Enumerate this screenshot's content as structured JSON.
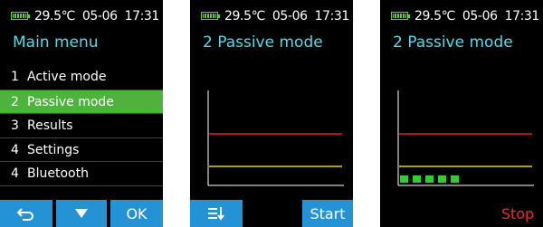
{
  "status": {
    "temperature": "29.5℃",
    "date": "05-06",
    "time": "17:31"
  },
  "main_menu": {
    "title": "Main  menu",
    "items": [
      {
        "num": "1",
        "label": "Active mode"
      },
      {
        "num": "2",
        "label": "Passive mode",
        "selected": true
      },
      {
        "num": "3",
        "label": "Results"
      },
      {
        "num": "4",
        "label": "Settings"
      },
      {
        "num": "4",
        "label": "Bluetooth"
      }
    ],
    "buttons": {
      "back_icon": "back-arrow-icon",
      "down_icon": "down-triangle-icon",
      "ok_label": "OK"
    }
  },
  "passive_screen": {
    "title": "2 Passive mode",
    "menu_icon": "list-sort-icon",
    "start_label": "Start"
  },
  "passive_running_screen": {
    "title": "2 Passive mode",
    "stop_label": "Stop",
    "progress_blocks_filled": 5
  },
  "colors": {
    "title": "#5cd6e8",
    "selected_row": "#4db33d",
    "button_bg": "#2493d6",
    "battery": "#66cc33",
    "upper_line": "#e02020",
    "lower_line": "#e8d020",
    "progress": "#33cc33",
    "stop_text": "#e03030"
  }
}
